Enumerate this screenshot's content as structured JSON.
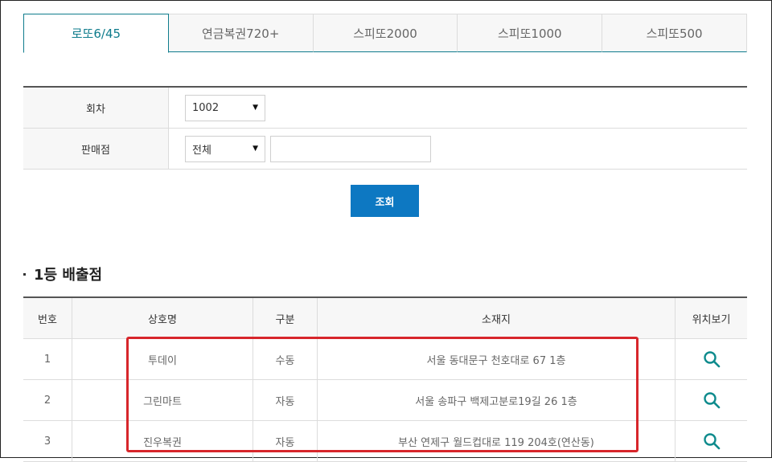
{
  "tabs": [
    {
      "label": "로또6/45",
      "active": true
    },
    {
      "label": "연금복권720+",
      "active": false
    },
    {
      "label": "스피또2000",
      "active": false
    },
    {
      "label": "스피또1000",
      "active": false
    },
    {
      "label": "스피또500",
      "active": false
    }
  ],
  "form": {
    "round_label": "회차",
    "round_value": "1002",
    "store_label": "판매점",
    "store_filter_value": "전체",
    "store_name_value": ""
  },
  "search_button": "조회",
  "section_title": "1등 배출점",
  "table": {
    "headers": {
      "no": "번호",
      "name": "상호명",
      "type": "구분",
      "address": "소재지",
      "map": "위치보기"
    },
    "rows": [
      {
        "no": "1",
        "name": "투데이",
        "type": "수동",
        "address": "서울 동대문구 천호대로 67 1층"
      },
      {
        "no": "2",
        "name": "그린마트",
        "type": "자동",
        "address": "서울 송파구 백제고분로19길 26 1층"
      },
      {
        "no": "3",
        "name": "진우복권",
        "type": "자동",
        "address": "부산 연제구 월드컵대로 119 204호(연산동)"
      }
    ]
  },
  "colors": {
    "accent": "#0f7c8c",
    "button": "#0d78c2",
    "highlight": "#d7262b"
  },
  "icons": {
    "map": "search-icon",
    "dropdown": "caret-down-icon"
  }
}
